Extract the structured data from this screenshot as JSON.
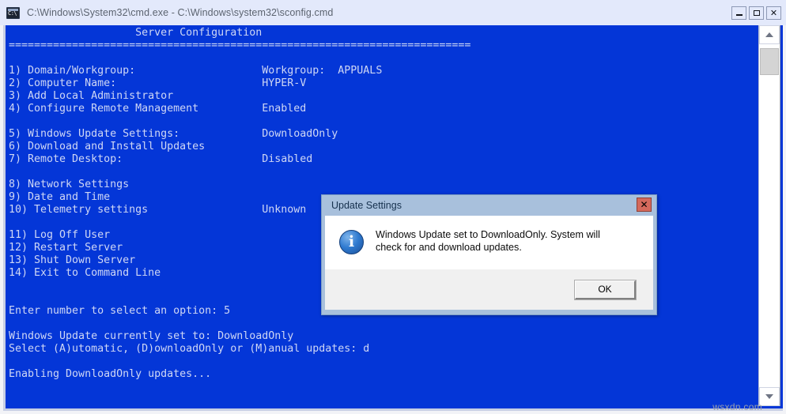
{
  "window": {
    "title": "C:\\Windows\\System32\\cmd.exe - C:\\Windows\\system32\\sconfig.cmd",
    "icon": "cmd-console-icon",
    "controls": {
      "minimize_label": "–",
      "maximize_label": "□",
      "close_label": "✕"
    }
  },
  "console": {
    "background_color": "#0436d7",
    "text_color": "#cfd7f5",
    "content": "                    Server Configuration\n=========================================================================\n\n1) Domain/Workgroup:                    Workgroup:  APPUALS\n2) Computer Name:                       HYPER-V\n3) Add Local Administrator\n4) Configure Remote Management          Enabled\n\n5) Windows Update Settings:             DownloadOnly\n6) Download and Install Updates\n7) Remote Desktop:                      Disabled\n\n8) Network Settings\n9) Date and Time\n10) Telemetry settings                  Unknown\n\n11) Log Off User\n12) Restart Server\n13) Shut Down Server\n14) Exit to Command Line\n\n\nEnter number to select an option: 5\n\nWindows Update currently set to: DownloadOnly\nSelect (A)utomatic, (D)ownloadOnly or (M)anual updates: d\n\nEnabling DownloadOnly updates...",
    "heading": "Server Configuration",
    "separator": "=========================================================================",
    "menu_items": [
      {
        "number": "1)",
        "label": "Domain/Workgroup:",
        "value": "Workgroup:  APPUALS"
      },
      {
        "number": "2)",
        "label": "Computer Name:",
        "value": "HYPER-V"
      },
      {
        "number": "3)",
        "label": "Add Local Administrator",
        "value": ""
      },
      {
        "number": "4)",
        "label": "Configure Remote Management",
        "value": "Enabled"
      },
      {
        "number": "5)",
        "label": "Windows Update Settings:",
        "value": "DownloadOnly"
      },
      {
        "number": "6)",
        "label": "Download and Install Updates",
        "value": ""
      },
      {
        "number": "7)",
        "label": "Remote Desktop:",
        "value": "Disabled"
      },
      {
        "number": "8)",
        "label": "Network Settings",
        "value": ""
      },
      {
        "number": "9)",
        "label": "Date and Time",
        "value": ""
      },
      {
        "number": "10)",
        "label": "Telemetry settings",
        "value": "Unknown"
      },
      {
        "number": "11)",
        "label": "Log Off User",
        "value": ""
      },
      {
        "number": "12)",
        "label": "Restart Server",
        "value": ""
      },
      {
        "number": "13)",
        "label": "Shut Down Server",
        "value": ""
      },
      {
        "number": "14)",
        "label": "Exit to Command Line",
        "value": ""
      }
    ],
    "prompt_line": "Enter number to select an option: 5",
    "status_line_1": "Windows Update currently set to: DownloadOnly",
    "status_line_2": "Select (A)utomatic, (D)ownloadOnly or (M)anual updates: d",
    "status_line_3": "Enabling DownloadOnly updates..."
  },
  "scrollbar": {
    "up_arrow": "scroll-up-arrow-icon",
    "down_arrow": "scroll-down-arrow-icon"
  },
  "dialog": {
    "title": "Update Settings",
    "close_label": "✕",
    "icon": "information-icon",
    "message": "Windows Update set to DownloadOnly.  System will check for and download updates.",
    "ok_label": "OK",
    "title_bar_color": "#a8c0dc",
    "close_button_color": "#d4695c"
  },
  "watermark": {
    "text": "wsxdn.com"
  }
}
